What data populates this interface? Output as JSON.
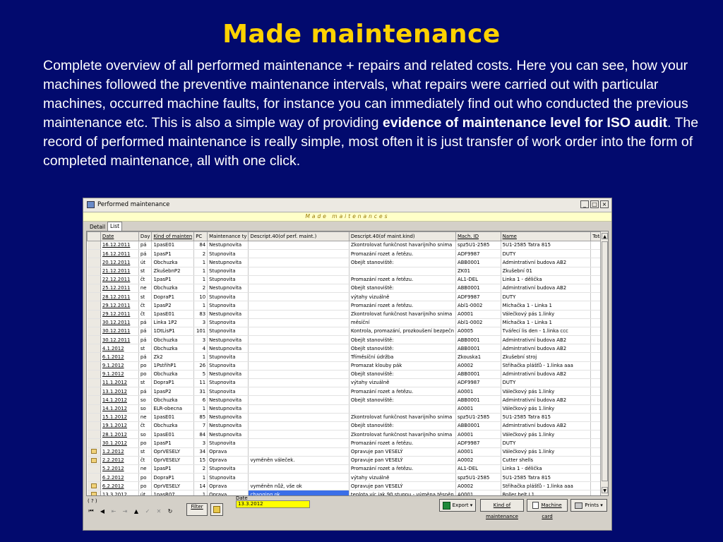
{
  "slide": {
    "title": "Made maintenance",
    "text_part1": "Complete overview of all performed maintenance + repairs and related costs. Here you can see, how your machines followed the preventive maintenance intervals, what repairs were carried out with particular machines, occurred machine faults, for instance you can immediately find out who conducted the previous maintenance etc. This is also a simple way of providing ",
    "text_bold": "evidence of maintenance level for ISO audit",
    "text_part2": ". The record of performed maintenance is really simple, most often it is just transfer of work order into the form of completed maintenance, all with one click."
  },
  "window": {
    "title": "Performed maintenance",
    "banner": "Made maitenances",
    "min_label": "_",
    "max_label": "□",
    "close_label": "×",
    "tabs": [
      "Detail",
      "List"
    ]
  },
  "grid": {
    "columns": [
      "Date",
      "Day",
      "Kind of mainten",
      "PC",
      "Maintenance ty",
      "Descript.40(of perf. maint.)",
      "Descript.40(of maint.kind)",
      "Mach. ID",
      "Name",
      "Total"
    ],
    "rows": [
      {
        "icon": false,
        "date": "16.12.2011",
        "day": "pá",
        "kind": "1pasE01",
        "pc": "84",
        "type": "Nestupnovita",
        "desc": "",
        "dkind": "Zkontrolovat funkčnost havarijního snima",
        "mach": "spz5U1-2585",
        "name": "5U1-2585 Tatra 815",
        "sel": false
      },
      {
        "icon": false,
        "date": "16.12.2011",
        "day": "pá",
        "kind": "1pasP1",
        "pc": "2",
        "type": "Stupnovita",
        "desc": "",
        "dkind": "Promazání rozet a řetězu.",
        "mach": "ADF9987",
        "name": "DUTY",
        "sel": false
      },
      {
        "icon": false,
        "date": "20.12.2011",
        "day": "út",
        "kind": "Obchuzka",
        "pc": "1",
        "type": "Nestupnovita",
        "desc": "",
        "dkind": "Obejít stanoviště:",
        "mach": "ABB0001",
        "name": "Admintrativní budova AB2",
        "sel": false
      },
      {
        "icon": false,
        "date": "21.12.2011",
        "day": "st",
        "kind": "ZkušebnP2",
        "pc": "1",
        "type": "Stupnovita",
        "desc": "",
        "dkind": "",
        "mach": "ZK01",
        "name": "Zkušební 01",
        "sel": false
      },
      {
        "icon": false,
        "date": "22.12.2011",
        "day": "čt",
        "kind": "1pasP1",
        "pc": "1",
        "type": "Stupnovita",
        "desc": "",
        "dkind": "Promazání rozet a řetězu.",
        "mach": "AL1-DEL",
        "name": "Linka 1 - dělička",
        "sel": false
      },
      {
        "icon": false,
        "date": "25.12.2011",
        "day": "ne",
        "kind": "Obchuzka",
        "pc": "2",
        "type": "Nestupnovita",
        "desc": "",
        "dkind": "Obejít stanoviště:",
        "mach": "ABB0001",
        "name": "Admintrativní budova AB2",
        "sel": false
      },
      {
        "icon": false,
        "date": "28.12.2011",
        "day": "st",
        "kind": "DopraP1",
        "pc": "10",
        "type": "Stupnovita",
        "desc": "",
        "dkind": "výtahy vizuálně",
        "mach": "ADF9987",
        "name": "DUTY",
        "sel": false
      },
      {
        "icon": false,
        "date": "29.12.2011",
        "day": "čt",
        "kind": "1pasP2",
        "pc": "1",
        "type": "Stupnovita",
        "desc": "",
        "dkind": "Promazání rozet a řetězu.",
        "mach": "Abl1-0002",
        "name": " Míchačka 1 - Linka 1",
        "sel": false
      },
      {
        "icon": false,
        "date": "29.12.2011",
        "day": "čt",
        "kind": "1pasE01",
        "pc": "83",
        "type": "Nestupnovita",
        "desc": "",
        "dkind": "Zkontrolovat funkčnost havarijního snima",
        "mach": "A0001",
        "name": "Válečkový pás 1.linky",
        "sel": false
      },
      {
        "icon": false,
        "date": "30.12.2011",
        "day": "pá",
        "kind": "Linka 1P2",
        "pc": "3",
        "type": "Stupnovita",
        "desc": "",
        "dkind": "měsíční",
        "mach": "Abl1-0002",
        "name": " Míchačka 1 - Linka 1",
        "sel": false
      },
      {
        "icon": false,
        "date": "30.12.2011",
        "day": "pá",
        "kind": "1DtLisP1",
        "pc": "101",
        "type": "Stupnovita",
        "desc": "",
        "dkind": "Kontrola, promazání, prozkoušení bezpečn",
        "mach": "A0005",
        "name": "Tvářecí lis den - 1.linka ccc",
        "sel": false
      },
      {
        "icon": false,
        "date": "30.12.2011",
        "day": "pá",
        "kind": "Obchuzka",
        "pc": "3",
        "type": "Nestupnovita",
        "desc": "",
        "dkind": "Obejít stanoviště:",
        "mach": "ABB0001",
        "name": "Admintrativní budova AB2",
        "sel": false
      },
      {
        "icon": false,
        "date": "4.1.2012",
        "day": "st",
        "kind": "Obchuzka",
        "pc": "4",
        "type": "Nestupnovita",
        "desc": "",
        "dkind": "Obejít stanoviště:",
        "mach": "ABB0001",
        "name": "Admintrativní budova AB2",
        "sel": false
      },
      {
        "icon": false,
        "date": "6.1.2012",
        "day": "pá",
        "kind": "Zk2",
        "pc": "1",
        "type": "Stupnovita",
        "desc": "",
        "dkind": "Tříměsíční údržba",
        "mach": "Zkouska1",
        "name": "Zkušební stroj",
        "sel": false
      },
      {
        "icon": false,
        "date": "9.1.2012",
        "day": "po",
        "kind": "1PstřihP1",
        "pc": "26",
        "type": "Stupnovita",
        "desc": "",
        "dkind": "Promazat klouby pák",
        "mach": "A0002",
        "name": "Střihačka plášťů - 1.linka aaa",
        "sel": false
      },
      {
        "icon": false,
        "date": "9.1.2012",
        "day": "po",
        "kind": "Obchuzka",
        "pc": "5",
        "type": "Nestupnovita",
        "desc": "",
        "dkind": "Obejít stanoviště:",
        "mach": "ABB0001",
        "name": "Admintrativní budova AB2",
        "sel": false
      },
      {
        "icon": false,
        "date": "11.1.2012",
        "day": "st",
        "kind": "DopraP1",
        "pc": "11",
        "type": "Stupnovita",
        "desc": "",
        "dkind": "výtahy vizuálně",
        "mach": "ADF9987",
        "name": "DUTY",
        "sel": false
      },
      {
        "icon": false,
        "date": "13.1.2012",
        "day": "pá",
        "kind": "1pasP2",
        "pc": "31",
        "type": "Stupnovita",
        "desc": "",
        "dkind": "Promazání rozet a řetězu.",
        "mach": "A0001",
        "name": "Válečkový pás 1.linky",
        "sel": false
      },
      {
        "icon": false,
        "date": "14.1.2012",
        "day": "so",
        "kind": "Obchuzka",
        "pc": "6",
        "type": "Nestupnovita",
        "desc": "",
        "dkind": "Obejít stanoviště:",
        "mach": "ABB0001",
        "name": "Admintrativní budova AB2",
        "sel": false
      },
      {
        "icon": false,
        "date": "14.1.2012",
        "day": "so",
        "kind": "ELR-obecna",
        "pc": "1",
        "type": "Nestupnovita",
        "desc": "",
        "dkind": "",
        "mach": "A0001",
        "name": "Válečkový pás 1.linky",
        "sel": false
      },
      {
        "icon": false,
        "date": "15.1.2012",
        "day": "ne",
        "kind": "1pasE01",
        "pc": "85",
        "type": "Nestupnovita",
        "desc": "",
        "dkind": "Zkontrolovat funkčnost havarijního snima",
        "mach": "spz5U1-2585",
        "name": "5U1-2585 Tatra 815",
        "sel": false
      },
      {
        "icon": false,
        "date": "19.1.2012",
        "day": "čt",
        "kind": "Obchuzka",
        "pc": "7",
        "type": "Nestupnovita",
        "desc": "",
        "dkind": "Obejít stanoviště:",
        "mach": "ABB0001",
        "name": "Admintrativní budova AB2",
        "sel": false
      },
      {
        "icon": false,
        "date": "28.1.2012",
        "day": "so",
        "kind": "1pasE01",
        "pc": "84",
        "type": "Nestupnovita",
        "desc": "",
        "dkind": "Zkontrolovat funkčnost havarijního snima",
        "mach": "A0001",
        "name": "Válečkový pás 1.linky",
        "sel": false
      },
      {
        "icon": false,
        "date": "30.1.2012",
        "day": "po",
        "kind": "1pasP1",
        "pc": "3",
        "type": "Stupnovita",
        "desc": "",
        "dkind": "Promazání rozet a řetězu.",
        "mach": "ADF9987",
        "name": "DUTY",
        "sel": false
      },
      {
        "icon": true,
        "date": "1.2.2012",
        "day": "st",
        "kind": "OprVESELY",
        "pc": "34",
        "type": "Oprava",
        "desc": "",
        "dkind": "Opravuje pan VESELÝ",
        "mach": "A0001",
        "name": "Válečkový pás 1.linky",
        "sel": false
      },
      {
        "icon": true,
        "date": "2.2.2012",
        "day": "čt",
        "kind": "OprVESELY",
        "pc": "15",
        "type": "Oprava",
        "desc": "vyměněn váleček.",
        "dkind": "Opravuje pan VESELÝ",
        "mach": "A0002",
        "name": "Cutter shells",
        "sel": false
      },
      {
        "icon": false,
        "date": "5.2.2012",
        "day": "ne",
        "kind": "1pasP1",
        "pc": "2",
        "type": "Stupnovita",
        "desc": "",
        "dkind": "Promazání rozet a řetězu.",
        "mach": "AL1-DEL",
        "name": "Linka 1 - dělička",
        "sel": false
      },
      {
        "icon": false,
        "date": "6.2.2012",
        "day": "po",
        "kind": "DopraP1",
        "pc": "1",
        "type": "Stupnovita",
        "desc": "",
        "dkind": "výtahy vizuálně",
        "mach": "spz5U1-2585",
        "name": "5U1-2585 Tatra 815",
        "sel": false
      },
      {
        "icon": true,
        "date": "6.2.2012",
        "day": "po",
        "kind": "OprVESELY",
        "pc": "14",
        "type": "Oprava",
        "desc": "vyměněn nůž, vše ok",
        "dkind": "Opravuje pan VESELÝ",
        "mach": "A0002",
        "name": "Střihačka plášťů - 1.linka aaa",
        "sel": false
      },
      {
        "icon": true,
        "date": "13.3.2012",
        "day": "út",
        "kind": "1pasR07",
        "pc": "1",
        "type": "Oprava",
        "desc": "changing ok",
        "dkind": "teplota víc jak 90 stupnu - výměna těsněn",
        "mach": "A0001",
        "name": "Roller belt L1",
        "sel": true
      }
    ]
  },
  "bottom": {
    "question": "( ? )",
    "nav": [
      "⏮",
      "◀",
      "⇤",
      "⇥",
      "▲",
      "✓",
      "✕",
      "↻"
    ],
    "filter_label": "Filter",
    "date_label": "Date",
    "date_value": "13.3.2012",
    "export_label": "Export",
    "kind_label": "Kind of maintenance",
    "machine_label": "Machine card",
    "prints_label": "Prints"
  }
}
